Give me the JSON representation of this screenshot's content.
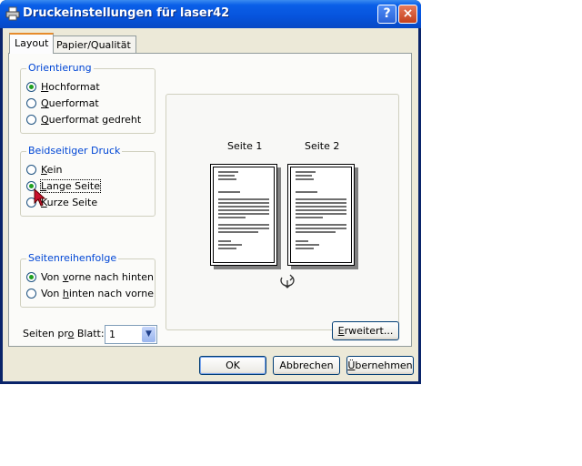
{
  "window": {
    "title": "Druckeinstellungen für laser42",
    "help_glyph": "?",
    "close_glyph": "×"
  },
  "tabs": [
    {
      "label": "Layout"
    },
    {
      "label": "Papier/Qualität"
    }
  ],
  "orientation": {
    "title": "Orientierung",
    "options": [
      {
        "pre": "",
        "acc": "H",
        "post": "ochformat",
        "selected": true
      },
      {
        "pre": "",
        "acc": "Q",
        "post": "uerformat",
        "selected": false
      },
      {
        "pre": "",
        "acc": "Q",
        "post": "uerformat gedreht",
        "selected": false
      }
    ]
  },
  "duplex": {
    "title": "Beidseitiger Druck",
    "options": [
      {
        "pre": "",
        "acc": "K",
        "post": "ein",
        "selected": false
      },
      {
        "pre": "",
        "acc": "L",
        "post": "ange Seite",
        "selected": true
      },
      {
        "pre": "",
        "acc": "K",
        "post": "urze Seite",
        "selected": false
      }
    ]
  },
  "page_order": {
    "title": "Seitenreihenfolge",
    "options": [
      {
        "pre": "Von ",
        "acc": "v",
        "post": "orne nach hinten",
        "selected": true
      },
      {
        "pre": "Von ",
        "acc": "h",
        "post": "inten nach vorne",
        "selected": false
      }
    ]
  },
  "pages_per_sheet": {
    "pre": "Seiten pr",
    "acc": "o",
    "post": " Blatt:",
    "value": "1"
  },
  "preview": {
    "page1_label": "Seite 1",
    "page2_label": "Seite 2"
  },
  "buttons": {
    "advanced": {
      "acc": "E",
      "post": "rweitert..."
    },
    "ok": "OK",
    "cancel": "Abbrechen",
    "apply": {
      "acc": "Ü",
      "post": "bernehmen"
    }
  },
  "colors": {
    "titlebar": "#0653dc",
    "group_title": "#0046d5",
    "dialog_bg": "#ece9d8",
    "radio_dot": "#21a121"
  },
  "icons": [
    "printer-icon",
    "help-icon",
    "close-icon",
    "chevron-down-icon",
    "duplex-flip-icon",
    "mouse-cursor-icon"
  ]
}
